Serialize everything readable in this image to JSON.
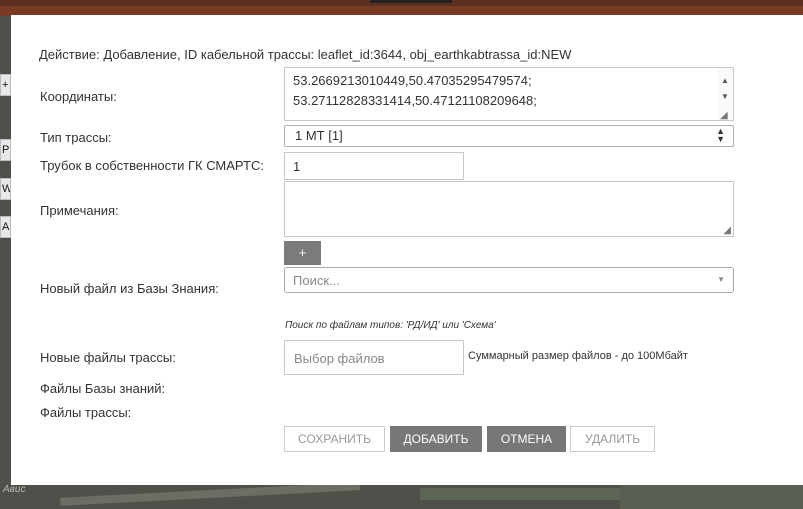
{
  "background": {
    "left_stub_chars": [
      "+",
      "Р",
      "W",
      "А"
    ],
    "map_label": "Авис"
  },
  "modal": {
    "header_line": "Действие: Добавление, ID кабельной трассы: leaflet_id:3644, obj_earthkabtrassa_id:NEW",
    "fields": {
      "coords": {
        "label": "Координаты:",
        "lines": [
          "53.2669213010449,50.47035295479574;",
          "53.27112828331414,50.47121108209648;"
        ]
      },
      "route_type": {
        "label": "Тип трассы:",
        "value": "1 МТ [1]"
      },
      "tubes": {
        "label": "Трубок в собственности ГК СМАРТС:",
        "value": "1"
      },
      "notes": {
        "label": "Примечания:",
        "value": "",
        "add_label": "+"
      },
      "kb_file": {
        "label": "Новый файл из Базы Знания:",
        "placeholder": "Поиск...",
        "hint": "Поиск по файлам типов: 'РД/ИД' или 'Схема'"
      },
      "route_files": {
        "label": "Новые файлы трассы:",
        "picker": "Выбор файлов",
        "size_note": "Суммарный размер файлов - до 100Мбайт"
      },
      "kb_files_label": "Файлы Базы знаний:",
      "route_files_label": "Файлы трассы:"
    },
    "buttons": {
      "save": "СОХРАНИТЬ",
      "add": "ДОБАВИТЬ",
      "cancel": "ОТМЕНА",
      "delete": "УДАЛИТЬ"
    }
  },
  "colors": {
    "primary_button": "#777777",
    "disabled_text": "#999999"
  }
}
